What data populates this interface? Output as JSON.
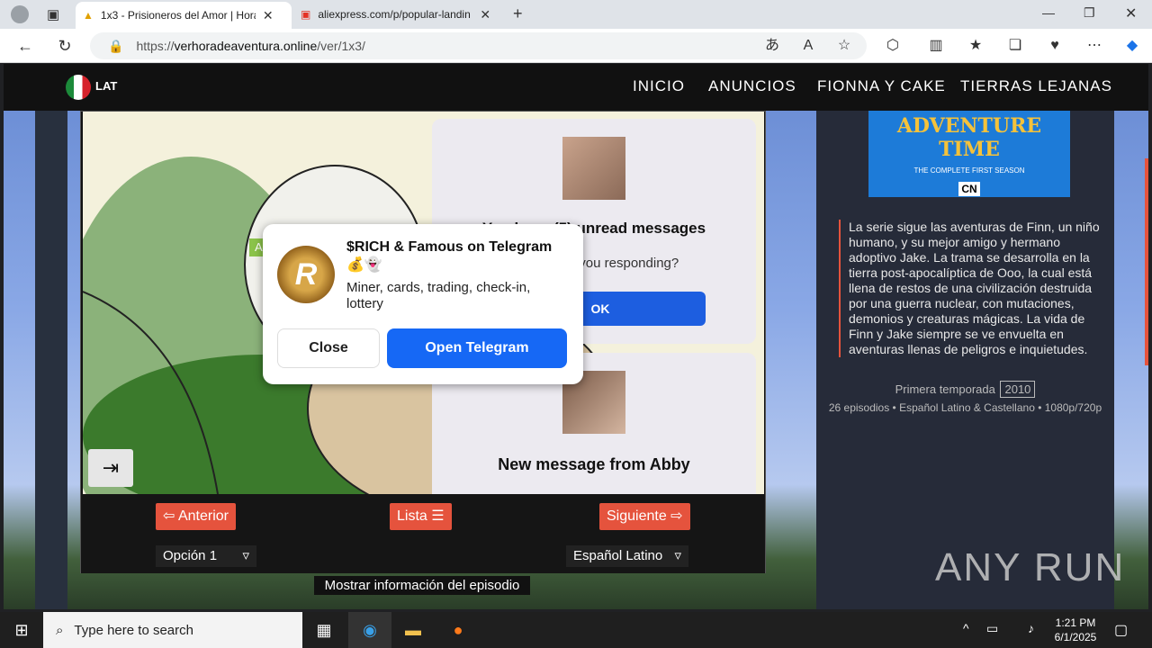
{
  "browser": {
    "tabs": [
      {
        "title": "1x3 - Prisioneros del Amor | Hora",
        "active": true
      },
      {
        "title": "aliexpress.com/p/popular-landin",
        "active": false
      }
    ],
    "url_prefix": "https://",
    "url_domain": "verhoradeaventura.online",
    "url_path": "/ver/1x3/"
  },
  "site": {
    "lang_label": "LAT",
    "nav": [
      "INICIO",
      "ANUNCIOS",
      "FIONNA Y CAKE",
      "TIERRAS LEJANAS"
    ]
  },
  "player": {
    "msg1_title": "You have (5) unread messages",
    "msg1_sub": "Why aren`t you responding?",
    "msg1_ok": "OK",
    "msg2_title": "New message from Abby",
    "prev_label": "⇦ Anterior",
    "list_label": "Lista ☰",
    "next_label": "Siguiente ⇨",
    "option_label": "Opción 1",
    "audio_label": "Español Latino",
    "show_info": "Mostrar información del episodio"
  },
  "ad": {
    "tag": "Ad",
    "title": "$RICH & Famous on Telegram 💰👻",
    "desc": "Miner, cards, trading, check-in, lottery",
    "close": "Close",
    "open": "Open Telegram"
  },
  "sidebar": {
    "poster_title": "ADVENTURE TIME",
    "poster_sub": "THE COMPLETE FIRST SEASON",
    "poster_logo": "CN",
    "description": "La serie sigue las aventuras de Finn, un niño humano, y su mejor amigo y hermano adoptivo Jake. La trama se desarrolla en la tierra post-apocalíptica de Ooo, la cual está llena de restos de una civilización destruida por una guerra nuclear, con mutaciones, demonios y creaturas mágicas. La vida de Finn y Jake siempre se ve envuelta en aventuras llenas de peligros e inquietudes.",
    "season_label": "Primera temporada",
    "year": "2010",
    "meta": "26 episodios • Español Latino & Castellano • 1080p/720p"
  },
  "watermark": "ANY RUN",
  "taskbar": {
    "search_placeholder": "Type here to search",
    "time": "1:21 PM",
    "date": "6/1/2025"
  }
}
